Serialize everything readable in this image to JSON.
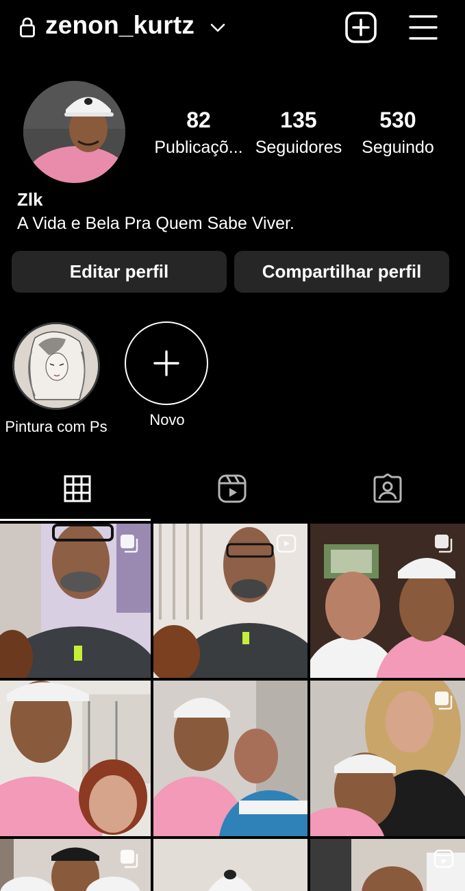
{
  "header": {
    "username": "zenon_kurtz",
    "icons": [
      "lock-icon",
      "chevron-down-icon",
      "plus-square-icon",
      "hamburger-menu-icon"
    ]
  },
  "profile": {
    "stats": [
      {
        "value": "82",
        "label": "Publicaçõ..."
      },
      {
        "value": "135",
        "label": "Seguidores"
      },
      {
        "value": "530",
        "label": "Seguindo"
      }
    ],
    "name": "Zlk",
    "bio": "A Vida e Bela Pra Quem Sabe Viver."
  },
  "buttons": {
    "edit": "Editar perfil",
    "share": "Compartilhar perfil"
  },
  "highlights": [
    {
      "label": "Pintura com Ps"
    },
    {
      "label": "Novo"
    }
  ],
  "tabs": [
    "grid-icon",
    "reels-icon",
    "tagged-icon"
  ],
  "colors": {
    "background": "#000000",
    "button": "#262626",
    "text": "#ffffff"
  }
}
